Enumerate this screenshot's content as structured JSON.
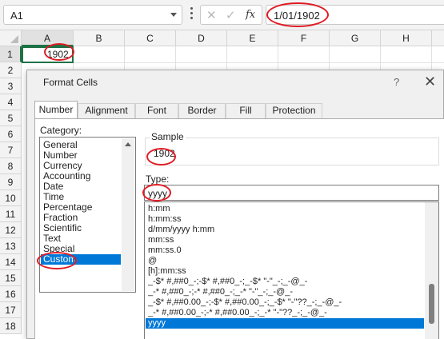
{
  "formula_bar": {
    "name_box": "A1",
    "cancel_glyph": "✕",
    "enter_glyph": "✓",
    "fx_label": "fx",
    "formula_value": "1/01/1902"
  },
  "sheet": {
    "columns": [
      "A",
      "B",
      "C",
      "D",
      "E",
      "F",
      "G",
      "H"
    ],
    "rows": [
      "1",
      "2",
      "3",
      "4",
      "5",
      "6",
      "7",
      "8",
      "9",
      "10",
      "11",
      "12",
      "13",
      "14",
      "15",
      "16",
      "17",
      "18"
    ],
    "cell_a1": "1902"
  },
  "dialog": {
    "title": "Format Cells",
    "help": "?",
    "close": "✕",
    "tabs": [
      "Number",
      "Alignment",
      "Font",
      "Border",
      "Fill",
      "Protection"
    ],
    "active_tab": "Number",
    "category_label": "Category:",
    "categories": [
      "General",
      "Number",
      "Currency",
      "Accounting",
      "Date",
      "Time",
      "Percentage",
      "Fraction",
      "Scientific",
      "Text",
      "Special",
      "Custom"
    ],
    "selected_category": "Custom",
    "sample_label": "Sample",
    "sample_value": "1902",
    "type_label": "Type:",
    "type_value": "yyyy",
    "format_list": [
      "h:mm",
      "h:mm:ss",
      "d/mm/yyyy h:mm",
      "mm:ss",
      "mm:ss.0",
      "@",
      "[h]:mm:ss",
      "_-$* #,##0_-;-$* #,##0_-;_-$* \"-\"_-;_-@_-",
      "_-* #,##0_-;-* #,##0_-;_-* \"-\"_-;_-@_-",
      "_-$* #,##0.00_-;-$* #,##0.00_-;_-$* \"-\"??_-;_-@_-",
      "_-* #,##0.00_-;-* #,##0.00_-;_-* \"-\"??_-;_-@_-",
      "yyyy"
    ],
    "selected_format": "yyyy"
  },
  "colors": {
    "accent_green": "#1e7145",
    "selection_blue": "#0078d7",
    "annotation_red": "#e01b24"
  }
}
